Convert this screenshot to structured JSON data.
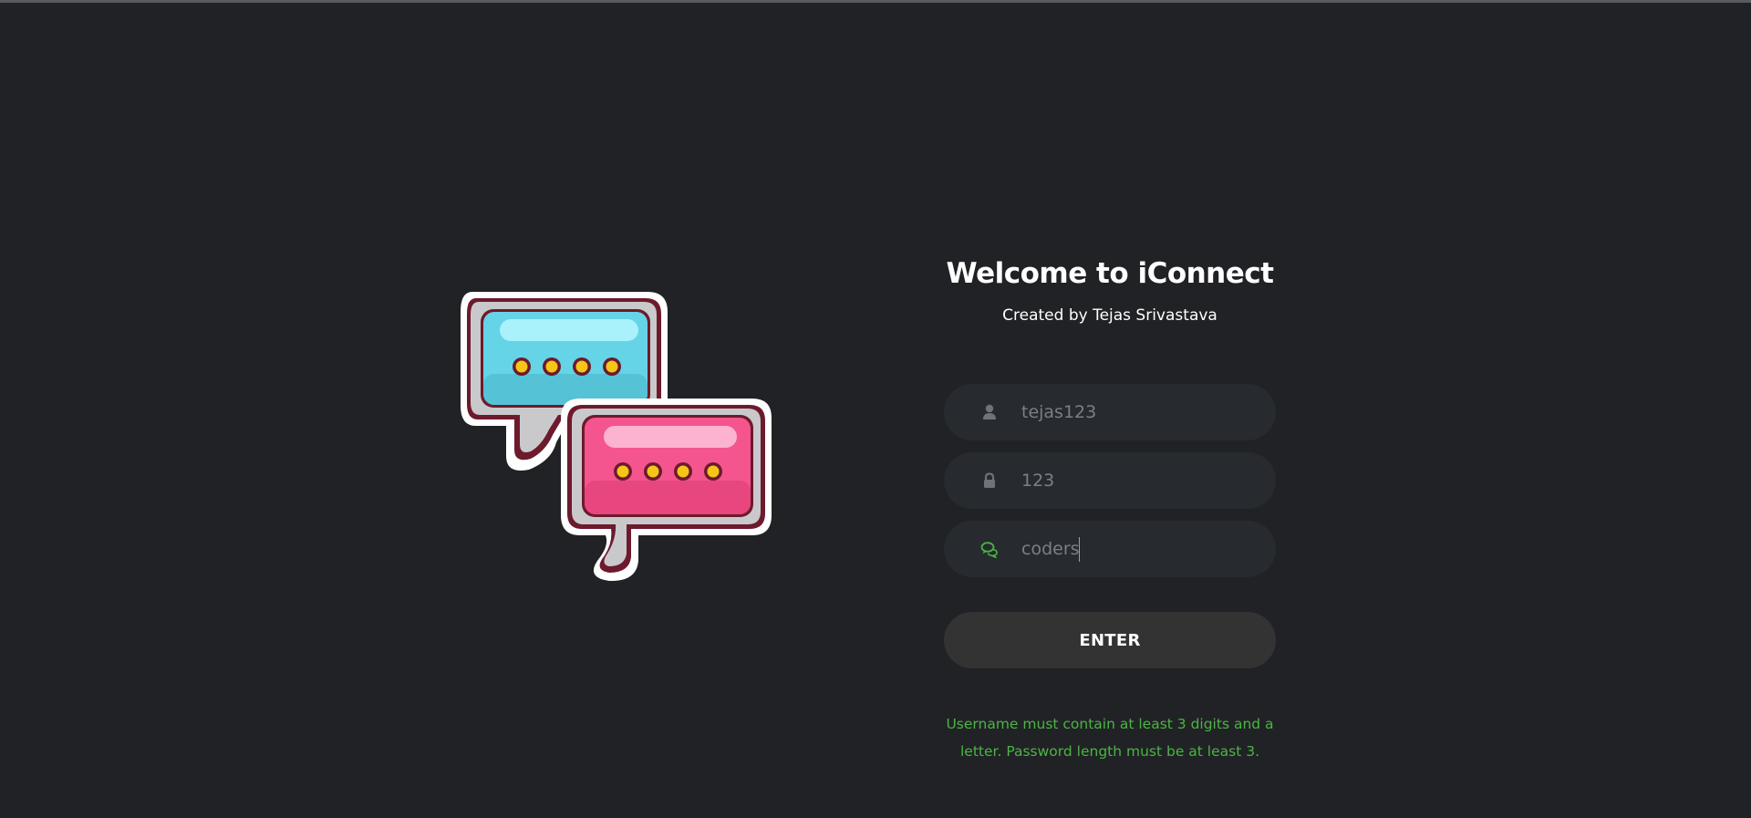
{
  "header": {
    "title": "Welcome to iConnect",
    "subtitle": "Created by Tejas Srivastava"
  },
  "form": {
    "username": {
      "value": "tejas123",
      "placeholder": "",
      "icon": "user-icon"
    },
    "password": {
      "value": "123",
      "placeholder": "",
      "icon": "lock-icon"
    },
    "room": {
      "value": "coders",
      "placeholder": "",
      "icon": "chat-icon"
    },
    "enter_label": "ENTER",
    "hint": "Username must contain at least 3 digits and a letter. Password length must be at least 3."
  },
  "illustration": {
    "name": "chat-bubbles-logo",
    "colors": {
      "blue": "#65d4e6",
      "pink": "#f4558f",
      "outline": "#6d1a2d",
      "dots": "#f5c518"
    }
  },
  "colors": {
    "background": "#212226",
    "field": "#272a2e",
    "button": "#333333",
    "accent_green": "#4bb543",
    "text": "#ffffff",
    "input_text": "#7c7f84"
  }
}
